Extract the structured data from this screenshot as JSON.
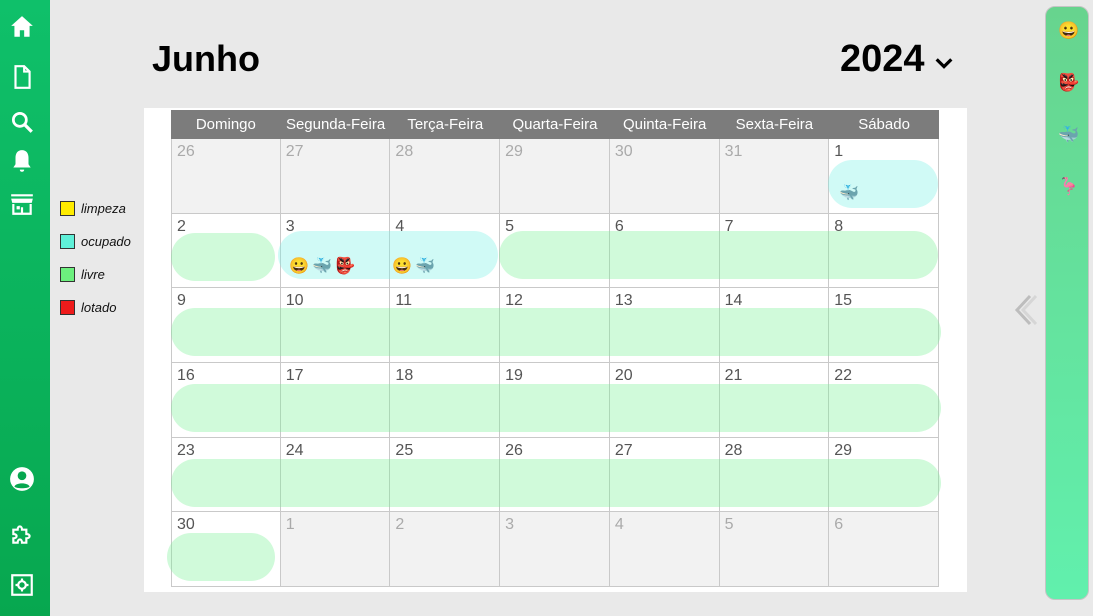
{
  "header": {
    "month": "Junho",
    "year": "2024"
  },
  "legend": [
    {
      "label": "limpeza",
      "color": "#ffec00"
    },
    {
      "label": "ocupado",
      "color": "#5ff0d8"
    },
    {
      "label": "livre",
      "color": "#6cf07e"
    },
    {
      "label": "lotado",
      "color": "#ee1b1b"
    }
  ],
  "nav": {
    "top": [
      "home-icon",
      "document-icon",
      "search-icon",
      "bell-icon",
      "store-icon"
    ],
    "bottom": [
      "user-icon",
      "puzzle-icon",
      "settings-icon"
    ]
  },
  "weekdays": [
    "Domingo",
    "Segunda-Feira",
    "Terça-Feira",
    "Quarta-Feira",
    "Quinta-Feira",
    "Sexta-Feira",
    "Sábado"
  ],
  "weeks": [
    [
      "26",
      "27",
      "28",
      "29",
      "30",
      "31",
      "1"
    ],
    [
      "2",
      "3",
      "4",
      "5",
      "6",
      "7",
      "8"
    ],
    [
      "9",
      "10",
      "11",
      "12",
      "13",
      "14",
      "15"
    ],
    [
      "16",
      "17",
      "18",
      "19",
      "20",
      "21",
      "22"
    ],
    [
      "23",
      "24",
      "25",
      "26",
      "27",
      "28",
      "29"
    ],
    [
      "30",
      "1",
      "2",
      "3",
      "4",
      "5",
      "6"
    ]
  ],
  "day_emojis": {
    "1": [
      "🐳"
    ],
    "3": [
      "😀",
      "🐳",
      "👺"
    ],
    "4": [
      "😀",
      "🐳"
    ]
  },
  "right_panel": [
    "😀",
    "👺",
    "🐳",
    "🦩"
  ]
}
